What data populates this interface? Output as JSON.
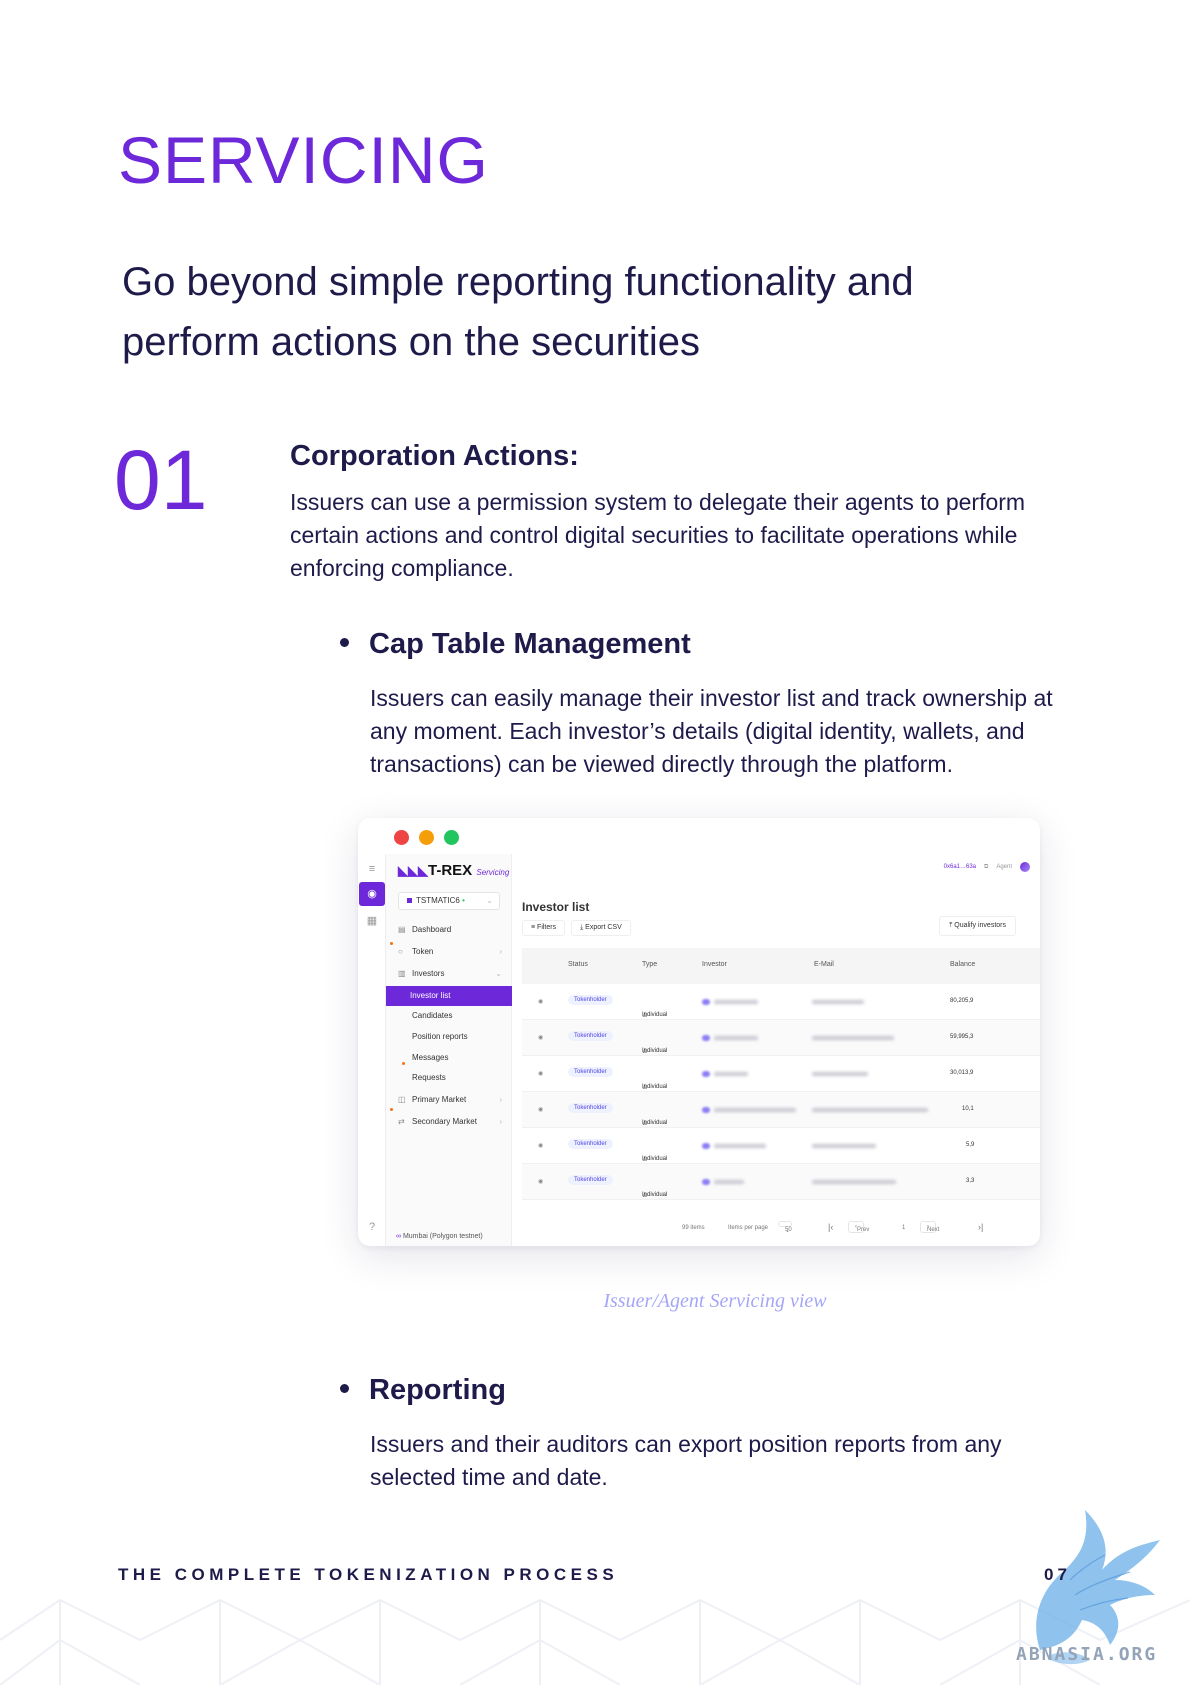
{
  "heading": "SERVICING",
  "subtitle": "Go beyond simple reporting functionality and perform actions on the securities",
  "section": {
    "number": "01",
    "title": "Corporation Actions:",
    "description": "Issuers can use a permission system to delegate their agents to perform certain actions and control digital securities to facilitate operations while enforcing compliance."
  },
  "bullets": [
    {
      "title": "Cap Table Management",
      "description": "Issuers can easily manage their investor list and track ownership at any moment. Each investor’s details (digital identity, wallets, and transactions) can be viewed directly through the platform."
    },
    {
      "title": "Reporting",
      "description": "Issuers and their auditors can export position reports from any selected time and date."
    }
  ],
  "screenshot": {
    "logo": "T-REX",
    "logo_sub": "Servicing",
    "token_selector": "TSTMATIC6",
    "topbar": {
      "wallet": "0x6a1…63a",
      "role": "Agent"
    },
    "nav": {
      "dashboard": "Dashboard",
      "token": "Token",
      "investors": "Investors",
      "investor_list": "Investor list",
      "candidates": "Candidates",
      "position_reports": "Position reports",
      "messages": "Messages",
      "requests": "Requests",
      "primary_market": "Primary Market",
      "secondary_market": "Secondary Market"
    },
    "network": "Mumbai (Polygon testnet)",
    "page_title": "Investor list",
    "filters_label": "Filters",
    "export_label": "Export CSV",
    "qualify_label": "Qualify investors",
    "columns": [
      "Status",
      "Type",
      "Investor",
      "E-Mail",
      "Balance"
    ],
    "rows": [
      {
        "status": "Tokenholder",
        "type": "Individual",
        "balance": "80,205,9"
      },
      {
        "status": "Tokenholder",
        "type": "Individual",
        "balance": "59,995,3"
      },
      {
        "status": "Tokenholder",
        "type": "Individual",
        "balance": "30,013,9"
      },
      {
        "status": "Tokenholder",
        "type": "Individual",
        "balance": "10,1"
      },
      {
        "status": "Tokenholder",
        "type": "Individual",
        "balance": "5,9"
      },
      {
        "status": "Tokenholder",
        "type": "Individual",
        "balance": "3,3"
      }
    ],
    "pager": {
      "rows_count": "99 items",
      "per_page_label": "Items per page",
      "per_page": "50",
      "prev": "Prev",
      "page": "1",
      "next": "Next"
    }
  },
  "caption": "Issuer/Agent Servicing view",
  "footer": {
    "title": "THE COMPLETE TOKENIZATION PROCESS",
    "page": "07"
  },
  "watermark": "ABNASIA.ORG",
  "colors": {
    "accent": "#6d28d9",
    "text": "#1e1b4b",
    "caption": "#a5a6f6"
  }
}
